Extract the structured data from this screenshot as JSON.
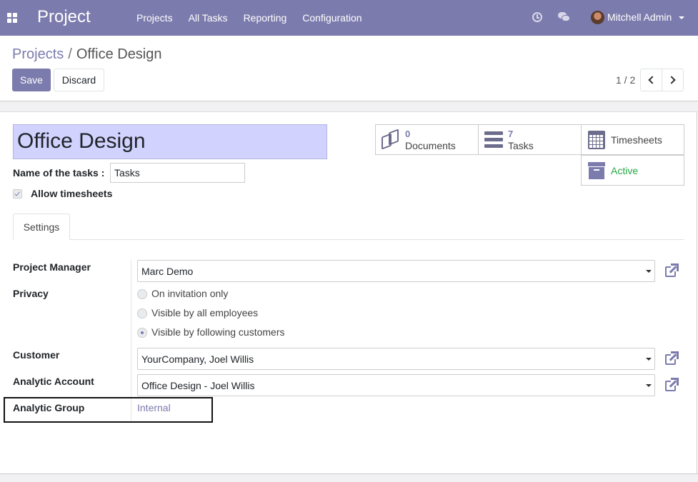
{
  "navbar": {
    "app_name": "Project",
    "menu": [
      "Projects",
      "All Tasks",
      "Reporting",
      "Configuration"
    ],
    "user_name": "Mitchell Admin",
    "accent_color": "#7c7bad"
  },
  "breadcrumb": {
    "parent": "Projects",
    "separator": "/",
    "current": "Office Design"
  },
  "actions": {
    "save_label": "Save",
    "discard_label": "Discard"
  },
  "pager": {
    "value": "1 / 2"
  },
  "form": {
    "name": "Office Design",
    "tasks_label": "Name of the tasks :",
    "tasks_value": "Tasks",
    "allow_timesheets_label": "Allow timesheets",
    "allow_timesheets_checked": true
  },
  "stat_buttons": {
    "documents": {
      "value": "0",
      "label": "Documents",
      "icon": "documents-icon"
    },
    "tasks": {
      "value": "7",
      "label": "Tasks",
      "icon": "tasks-icon"
    },
    "timesheets": {
      "label": "Timesheets",
      "icon": "calendar-icon"
    },
    "active": {
      "label": "Active",
      "icon": "archive-icon",
      "color": "#28a745"
    }
  },
  "tabs": [
    "Settings"
  ],
  "settings": {
    "project_manager_label": "Project Manager",
    "project_manager_value": "Marc Demo",
    "privacy_label": "Privacy",
    "privacy_options": [
      "On invitation only",
      "Visible by all employees",
      "Visible by following customers"
    ],
    "privacy_selected": "Visible by following customers",
    "customer_label": "Customer",
    "customer_value": "YourCompany, Joel Willis",
    "analytic_account_label": "Analytic Account",
    "analytic_account_value": "Office Design - Joel Willis",
    "analytic_group_label": "Analytic Group",
    "analytic_group_value": "Internal"
  }
}
